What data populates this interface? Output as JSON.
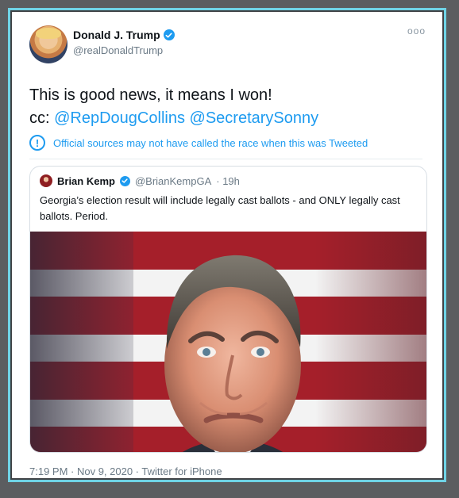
{
  "tweet": {
    "author_name": "Donald J. Trump",
    "author_handle": "@realDonaldTrump",
    "more_label": "ooo",
    "text_line_1": "This is good news, it means I won!",
    "text_line_2_prefix": "cc:",
    "mention_1": "@RepDougCollins",
    "mention_2": "@SecretarySonny",
    "notice": "Official sources may not have called the race when this was Tweeted",
    "notice_icon": "!",
    "footer": "7:19 PM · Nov 9, 2020 · Twitter for iPhone"
  },
  "quote": {
    "author_name": "Brian Kemp",
    "author_handle": "@BrianKempGA",
    "time": "· 19h",
    "text": "Georgia’s election result will include legally cast ballots - and ONLY legally cast ballots. Period."
  },
  "colors": {
    "accent": "#1d9bf0",
    "frame": "#6fd3e6",
    "background": "#5b5d60"
  },
  "icons": {
    "verified": "verified-badge-icon",
    "notice": "info-exclamation-icon"
  }
}
